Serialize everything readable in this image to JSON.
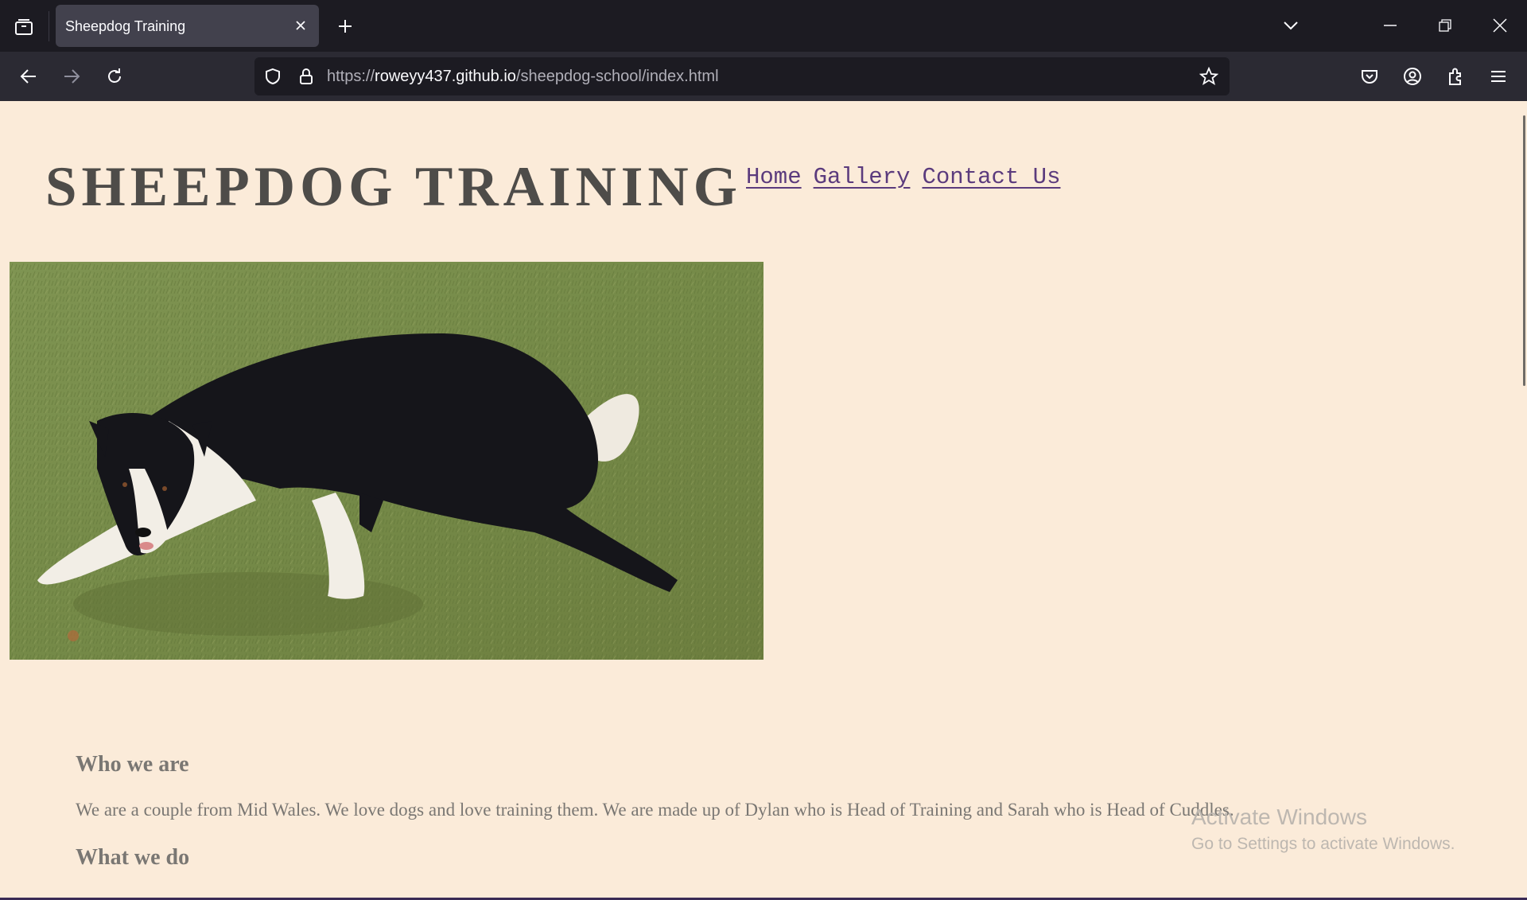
{
  "browser": {
    "tab_title": "Sheepdog Training",
    "url_prefix": "https://",
    "url_host": "roweyy437.github.io",
    "url_path": "/sheepdog-school/index.html"
  },
  "page": {
    "site_title": "SHEEPDOG TRAINING",
    "nav": [
      "Home",
      "Gallery",
      "Contact Us"
    ],
    "hero_alt": "Black and white border collie crouching on grass",
    "sections": [
      {
        "heading": "Who we are",
        "text": "We are a couple from Mid Wales. We love dogs and love training them. We are made up of Dylan who is Head of Training and Sarah who is Head of Cuddles."
      },
      {
        "heading": "What we do"
      }
    ],
    "background_color": "#fbebd9",
    "link_color": "#5b3b7d"
  },
  "os_watermark": {
    "line1": "Activate Windows",
    "line2": "Go to Settings to activate Windows."
  }
}
